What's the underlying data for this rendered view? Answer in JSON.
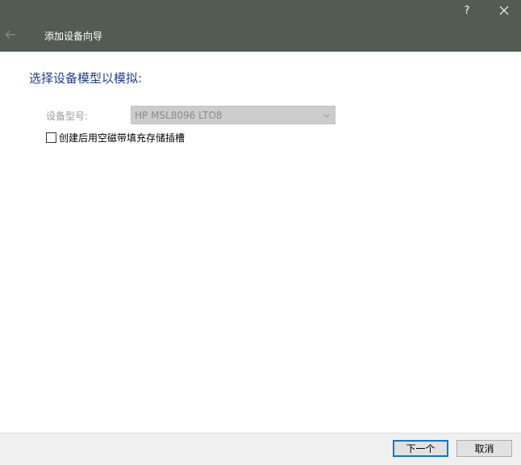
{
  "titlebar": {
    "help_label": "?",
    "wizard_title": "添加设备向导"
  },
  "colors": {
    "titlebar_bg": "#535b53",
    "heading": "#1f3c8c",
    "default_button_border": "#0078d7"
  },
  "main": {
    "heading": "选择设备模型以模拟:",
    "device_type_label": "设备型号:",
    "device_type_value": "HP MSL8096 LTO8",
    "device_type_enabled": false,
    "checkbox_label": "创建后用空磁带填充存储插槽",
    "checkbox_checked": false
  },
  "footer": {
    "next_label": "下一个",
    "cancel_label": "取消"
  },
  "icons": {
    "back": "back-arrow-icon",
    "close": "close-icon",
    "dropdown": "chevron-down-icon"
  }
}
